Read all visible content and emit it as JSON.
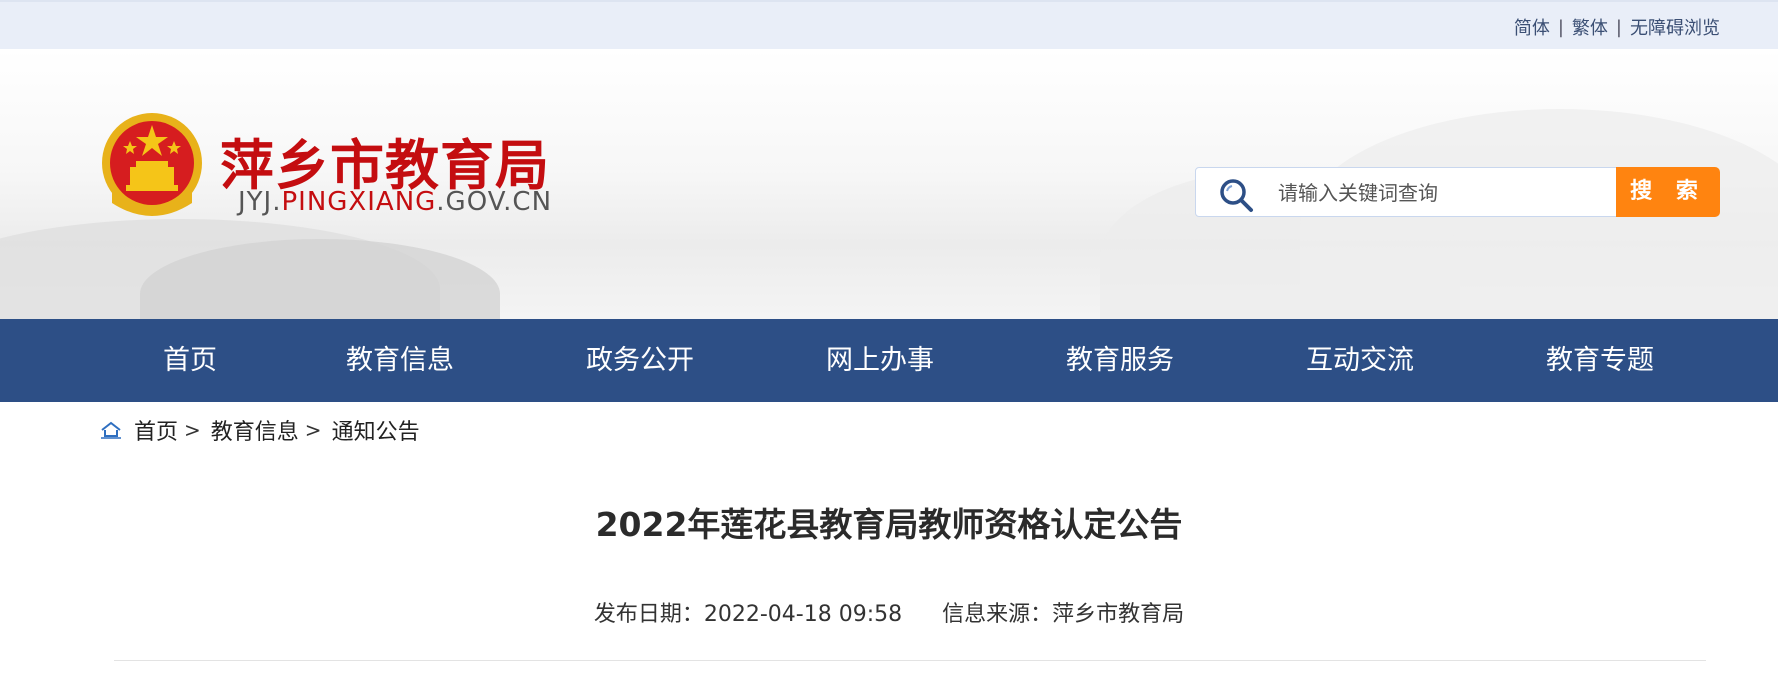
{
  "topbar": {
    "links": [
      "简体",
      "繁体",
      "无障碍浏览"
    ]
  },
  "header": {
    "site_name": "萍乡市教育局",
    "domain_prefix": "JYJ.",
    "domain_highlight": "PINGXIANG",
    "domain_suffix": ".GOV.CN",
    "search": {
      "placeholder": "请输入关键词查询",
      "button_label": "搜 索"
    }
  },
  "nav": {
    "items": [
      "首页",
      "教育信息",
      "政务公开",
      "网上办事",
      "教育服务",
      "互动交流",
      "教育专题"
    ]
  },
  "breadcrumb": {
    "items": [
      "首页",
      "教育信息",
      "通知公告"
    ]
  },
  "article": {
    "title": "2022年莲花县教育局教师资格认定公告",
    "publish_date": "发布日期：2022-04-18 09:58",
    "source": "信息来源：萍乡市教育局"
  },
  "colors": {
    "nav_bg": "#2d4f86",
    "brand_red": "#c40d10",
    "search_button": "#ff8410",
    "topbar_bg": "#e9eef8"
  }
}
